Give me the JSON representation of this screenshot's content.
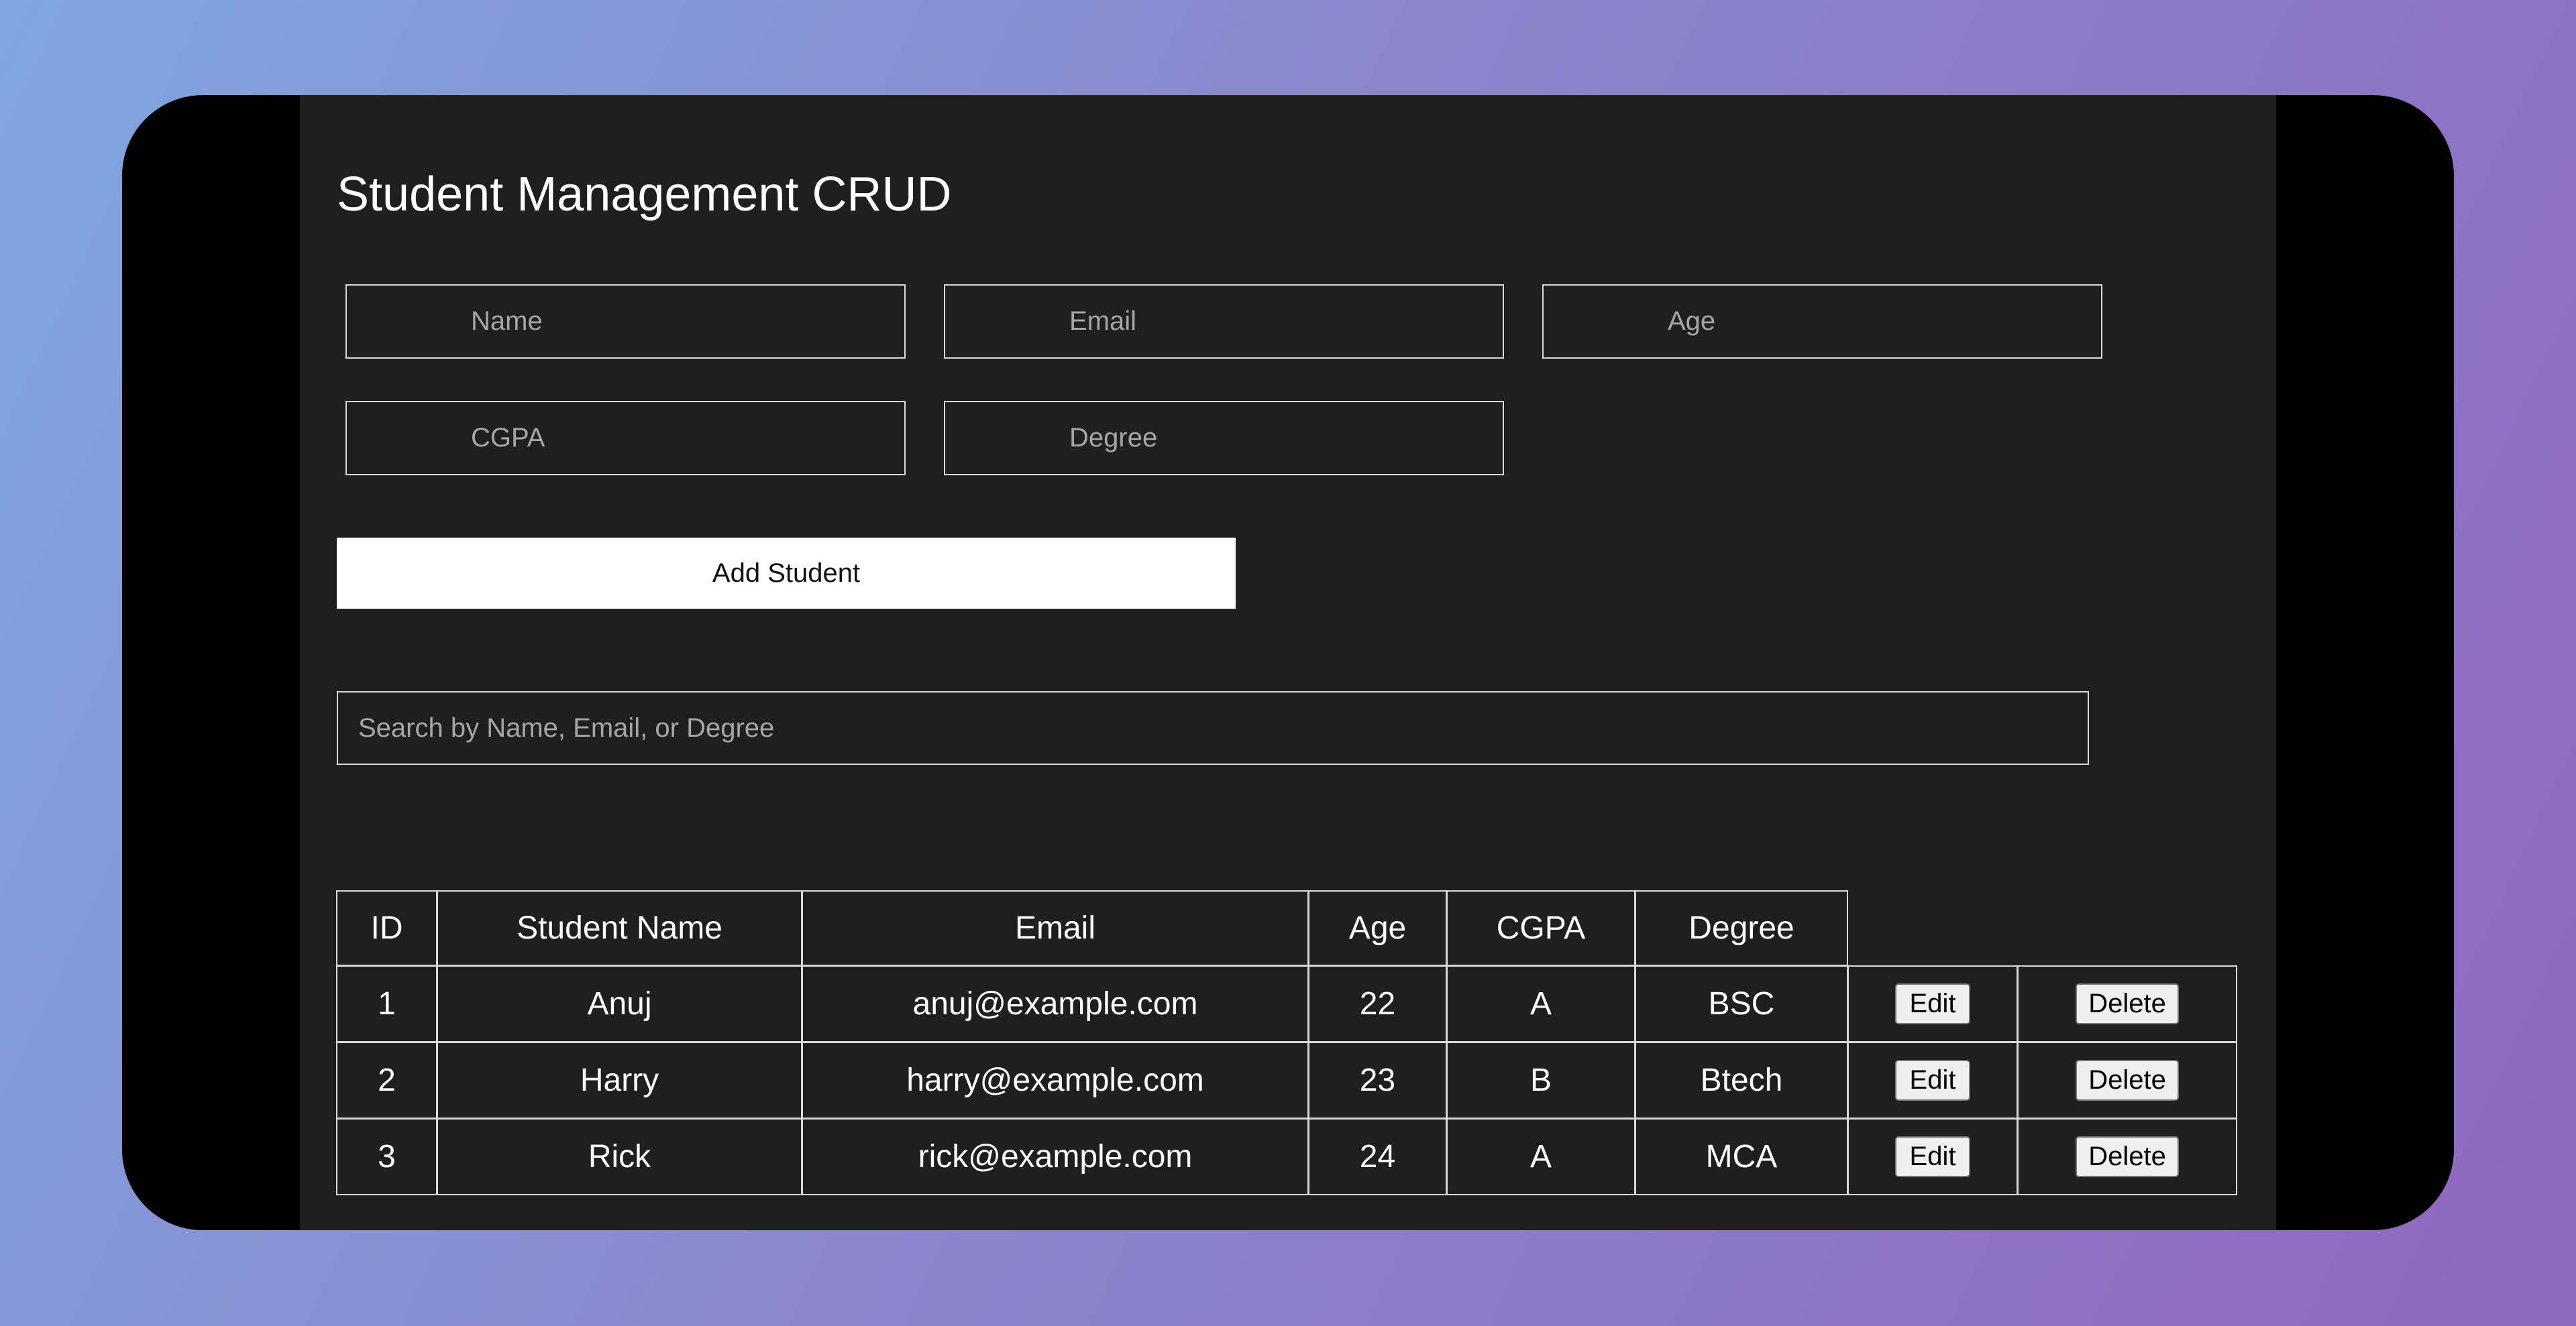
{
  "app": {
    "title": "Student Management CRUD"
  },
  "form": {
    "name_placeholder": "Name",
    "email_placeholder": "Email",
    "age_placeholder": "Age",
    "cgpa_placeholder": "CGPA",
    "degree_placeholder": "Degree",
    "add_button_label": "Add Student"
  },
  "search": {
    "placeholder": "Search by Name, Email, or Degree"
  },
  "table": {
    "headers": {
      "id": "ID",
      "name": "Student Name",
      "email": "Email",
      "age": "Age",
      "cgpa": "CGPA",
      "degree": "Degree"
    },
    "edit_label": "Edit",
    "delete_label": "Delete",
    "rows": [
      {
        "id": "1",
        "name": "Anuj",
        "email": "anuj@example.com",
        "age": "22",
        "cgpa": "A",
        "degree": "BSC"
      },
      {
        "id": "2",
        "name": "Harry",
        "email": "harry@example.com",
        "age": "23",
        "cgpa": "B",
        "degree": "Btech"
      },
      {
        "id": "3",
        "name": "Rick",
        "email": "rick@example.com",
        "age": "24",
        "cgpa": "A",
        "degree": "MCA"
      }
    ]
  }
}
